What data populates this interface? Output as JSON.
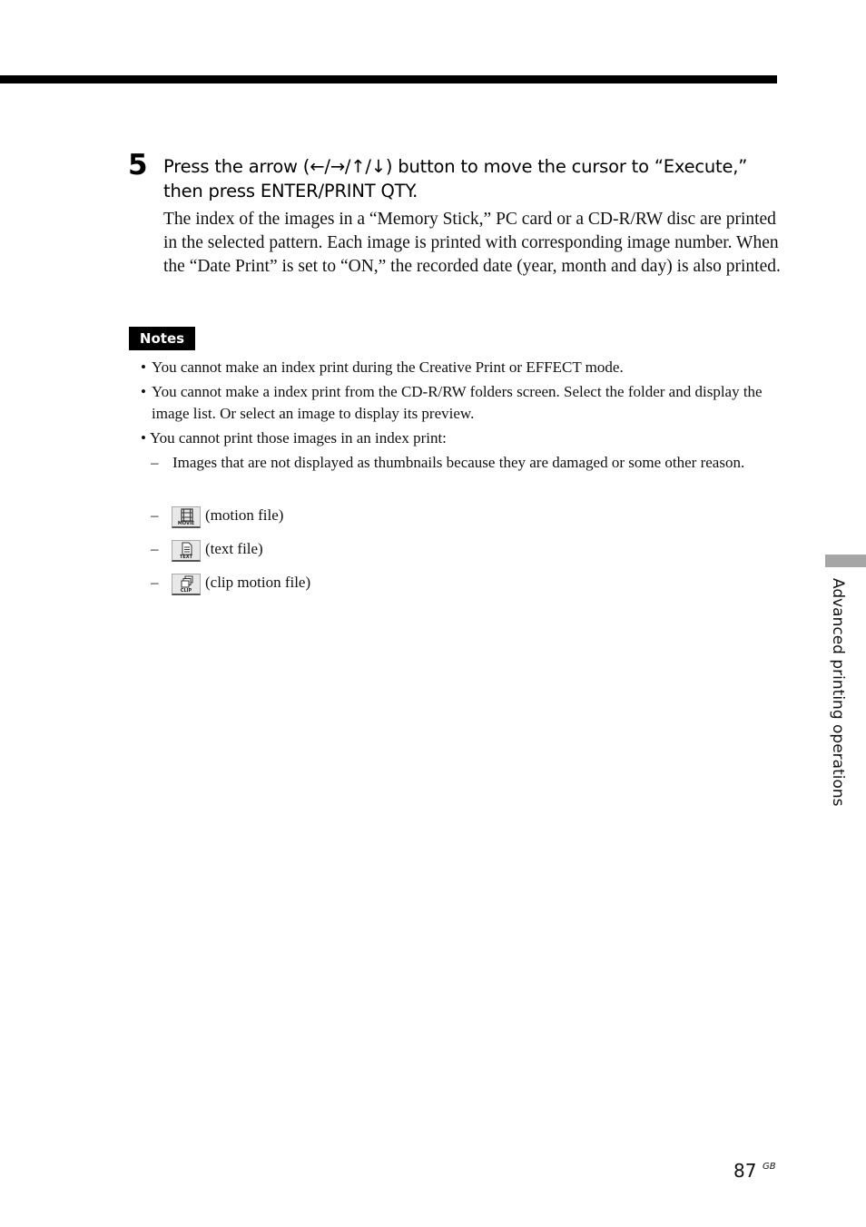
{
  "step": {
    "number": "5",
    "heading": "Press the arrow (←/→/↑/↓) button to move the cursor to “Execute,” then press ENTER/PRINT QTY.",
    "body": "The index of the images in a “Memory Stick,” PC card or a CD-R/RW disc are printed in the selected pattern. Each image is printed with corresponding image number. When the “Date Print” is set to “ON,” the recorded date (year, month and day) is also printed."
  },
  "notes": {
    "badge": "Notes",
    "bullet": "•",
    "dash": "–",
    "items": [
      "You cannot make an index print during the Creative Print or EFFECT mode.",
      "You cannot make a index print from the CD-R/RW folders screen.  Select the folder and display the image list.  Or select an image to display its preview.",
      "You cannot print those images in an index print:"
    ],
    "subitems": [
      "Images that are not displayed as thumbnails because they are damaged or some other reason."
    ],
    "file_types": [
      {
        "icon": "movie-file-icon",
        "icon_label": "MOVIE",
        "label": "(motion file)"
      },
      {
        "icon": "text-file-icon",
        "icon_label": "TEXT",
        "label": "(text file)"
      },
      {
        "icon": "clip-file-icon",
        "icon_label": "CLIP",
        "label": "(clip motion file)"
      }
    ]
  },
  "side_tab": {
    "label": "Advanced printing operations"
  },
  "footer": {
    "page_number": "87",
    "page_suffix": "GB"
  }
}
